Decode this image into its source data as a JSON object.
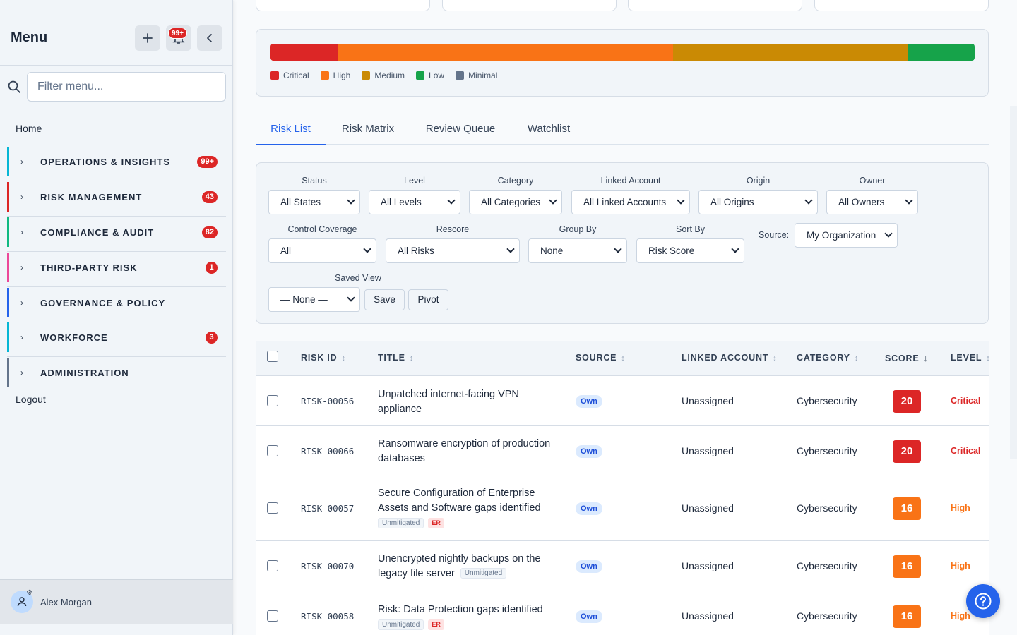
{
  "sidebar": {
    "title": "Menu",
    "notification_count": "99+",
    "filter_placeholder": "Filter menu...",
    "home": "Home",
    "groups": [
      {
        "label": "OPERATIONS & INSIGHTS",
        "count": "99+",
        "color": "#06b6d4"
      },
      {
        "label": "RISK MANAGEMENT",
        "count": "43",
        "color": "#dc2626"
      },
      {
        "label": "COMPLIANCE & AUDIT",
        "count": "82",
        "color": "#10b981"
      },
      {
        "label": "THIRD-PARTY RISK",
        "count": "1",
        "color": "#ec4899"
      },
      {
        "label": "GOVERNANCE & POLICY",
        "count": "",
        "color": "#2563eb"
      },
      {
        "label": "WORKFORCE",
        "count": "3",
        "color": "#06b6d4"
      },
      {
        "label": "ADMINISTRATION",
        "count": "",
        "color": "#64748b"
      }
    ],
    "logout": "Logout",
    "user_name": "Alex Morgan"
  },
  "distribution": {
    "segments": [
      {
        "level": "Critical",
        "fraction": 0.096,
        "color": "#dc2626"
      },
      {
        "level": "High",
        "fraction": 0.476,
        "color": "#f97316"
      },
      {
        "level": "Medium",
        "fraction": 0.333,
        "color": "#ca8a04"
      },
      {
        "level": "Low",
        "fraction": 0.095,
        "color": "#16a34a"
      },
      {
        "level": "Minimal",
        "fraction": 0.0,
        "color": "#64748b"
      }
    ],
    "legend": [
      "Critical",
      "High",
      "Medium",
      "Low",
      "Minimal"
    ]
  },
  "tabs": [
    {
      "label": "Risk List",
      "active": true
    },
    {
      "label": "Risk Matrix",
      "active": false
    },
    {
      "label": "Review Queue",
      "active": false
    },
    {
      "label": "Watchlist",
      "active": false
    }
  ],
  "filters": {
    "status": {
      "label": "Status",
      "value": "All States"
    },
    "level": {
      "label": "Level",
      "value": "All Levels"
    },
    "category": {
      "label": "Category",
      "value": "All Categories"
    },
    "linked_account": {
      "label": "Linked Account",
      "value": "All Linked Accounts"
    },
    "origin": {
      "label": "Origin",
      "value": "All Origins"
    },
    "owner": {
      "label": "Owner",
      "value": "All Owners"
    },
    "control_coverage": {
      "label": "Control Coverage",
      "value": "All"
    },
    "rescore": {
      "label": "Rescore",
      "value": "All Risks"
    },
    "group_by": {
      "label": "Group By",
      "value": "None"
    },
    "sort_by": {
      "label": "Sort By",
      "value": "Risk Score"
    },
    "source": {
      "label": "Source:",
      "value": "My Organization"
    },
    "saved_view": {
      "label": "Saved View",
      "value": "— None —"
    },
    "save_label": "Save",
    "pivot_label": "Pivot"
  },
  "table": {
    "columns": {
      "risk_id": "RISK ID",
      "title": "TITLE",
      "source": "SOURCE",
      "linked_account": "LINKED ACCOUNT",
      "category": "CATEGORY",
      "score": "SCORE",
      "level": "LEVEL"
    },
    "sort_icon": "↕",
    "sort_active_icon": "↓",
    "rows": [
      {
        "id": "RISK-00056",
        "title": "Unpatched internet-facing VPN appliance",
        "tags": [],
        "source": "Own",
        "linked_account": "Unassigned",
        "category": "Cybersecurity",
        "score": "20",
        "level": "Critical"
      },
      {
        "id": "RISK-00066",
        "title": "Ransomware encryption of production databases",
        "tags": [],
        "source": "Own",
        "linked_account": "Unassigned",
        "category": "Cybersecurity",
        "score": "20",
        "level": "Critical"
      },
      {
        "id": "RISK-00057",
        "title": "Secure Configuration of Enterprise Assets and Software gaps identified",
        "tags": [
          "Unmitigated",
          "ER"
        ],
        "source": "Own",
        "linked_account": "Unassigned",
        "category": "Cybersecurity",
        "score": "16",
        "level": "High"
      },
      {
        "id": "RISK-00070",
        "title": "Unencrypted nightly backups on the legacy file server",
        "tags": [
          "Unmitigated"
        ],
        "source": "Own",
        "linked_account": "Unassigned",
        "category": "Cybersecurity",
        "score": "16",
        "level": "High"
      },
      {
        "id": "RISK-00058",
        "title": "Risk: Data Protection gaps identified",
        "tags": [
          "Unmitigated",
          "ER"
        ],
        "source": "Own",
        "linked_account": "Unassigned",
        "category": "Cybersecurity",
        "score": "16",
        "level": "High"
      }
    ]
  },
  "colors": {
    "accent": "#2563eb",
    "critical": "#dc2626",
    "high": "#f97316",
    "critical_text": "#dc2626",
    "high_text": "#f97316"
  },
  "icons": {
    "add": "plus-icon",
    "bell": "bell-icon",
    "collapse": "chevron-left-icon",
    "search": "search-icon",
    "help": "help-icon",
    "user": "user-icon"
  }
}
